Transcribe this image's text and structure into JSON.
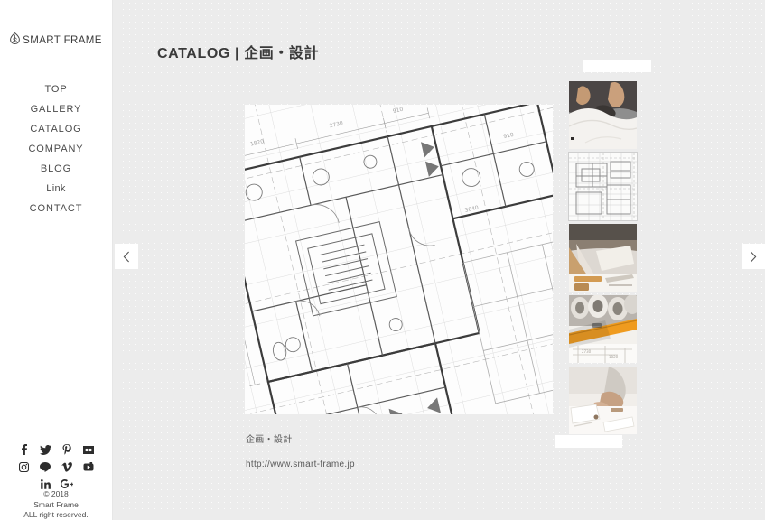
{
  "site": {
    "brand_name": "SMART FRAME",
    "brand_icon": "leaf-flame-logo-icon"
  },
  "sidebar": {
    "nav_items": [
      {
        "label": "TOP",
        "name": "top"
      },
      {
        "label": "GALLERY",
        "name": "gallery"
      },
      {
        "label": "CATALOG",
        "name": "catalog"
      },
      {
        "label": "COMPANY",
        "name": "company"
      },
      {
        "label": "BLOG",
        "name": "blog"
      },
      {
        "label": "Link",
        "name": "link"
      },
      {
        "label": "CONTACT",
        "name": "contact"
      }
    ],
    "social_links": [
      {
        "name": "facebook-icon"
      },
      {
        "name": "twitter-icon"
      },
      {
        "name": "pinterest-icon"
      },
      {
        "name": "flickr-icon"
      },
      {
        "name": "instagram-icon"
      },
      {
        "name": "line-icon"
      },
      {
        "name": "vimeo-icon"
      },
      {
        "name": "youtube-icon"
      },
      {
        "name": "linkedin-icon"
      },
      {
        "name": "googleplus-icon"
      }
    ],
    "copyright": {
      "line1": "© 2018",
      "line2": "Smart Frame",
      "line3": "ALL right reserved."
    }
  },
  "header": {
    "page_title": "CATALOG | 企画・設計"
  },
  "main": {
    "featured_image_alt": "architectural-blueprint-floor-plan",
    "caption_title": "企画・設計",
    "caption_url": "http://www.smart-frame.jp"
  },
  "thumbnails": [
    {
      "name": "thumb-model-making",
      "alt": "hands shaping white architectural model",
      "active": false
    },
    {
      "name": "thumb-floor-plan",
      "alt": "light grey blueprint floor plan drawing",
      "active": true
    },
    {
      "name": "thumb-drafting-desk",
      "alt": "wooden drafting desk with tools",
      "active": false
    },
    {
      "name": "thumb-rolled-plans",
      "alt": "rolled blueprints with orange spirit level",
      "active": false
    },
    {
      "name": "thumb-desk-work",
      "alt": "hands working over documents at desk",
      "active": false
    }
  ],
  "controls": {
    "prev_label": "‹",
    "next_label": "›",
    "thumbs_up_label": "",
    "thumbs_down_label": ""
  },
  "colors": {
    "page_bg": "#ececec",
    "sidebar_bg": "#ffffff",
    "text": "#4a4a4a",
    "title": "#3a3a3a",
    "accent_orange": "#e8a33d"
  }
}
